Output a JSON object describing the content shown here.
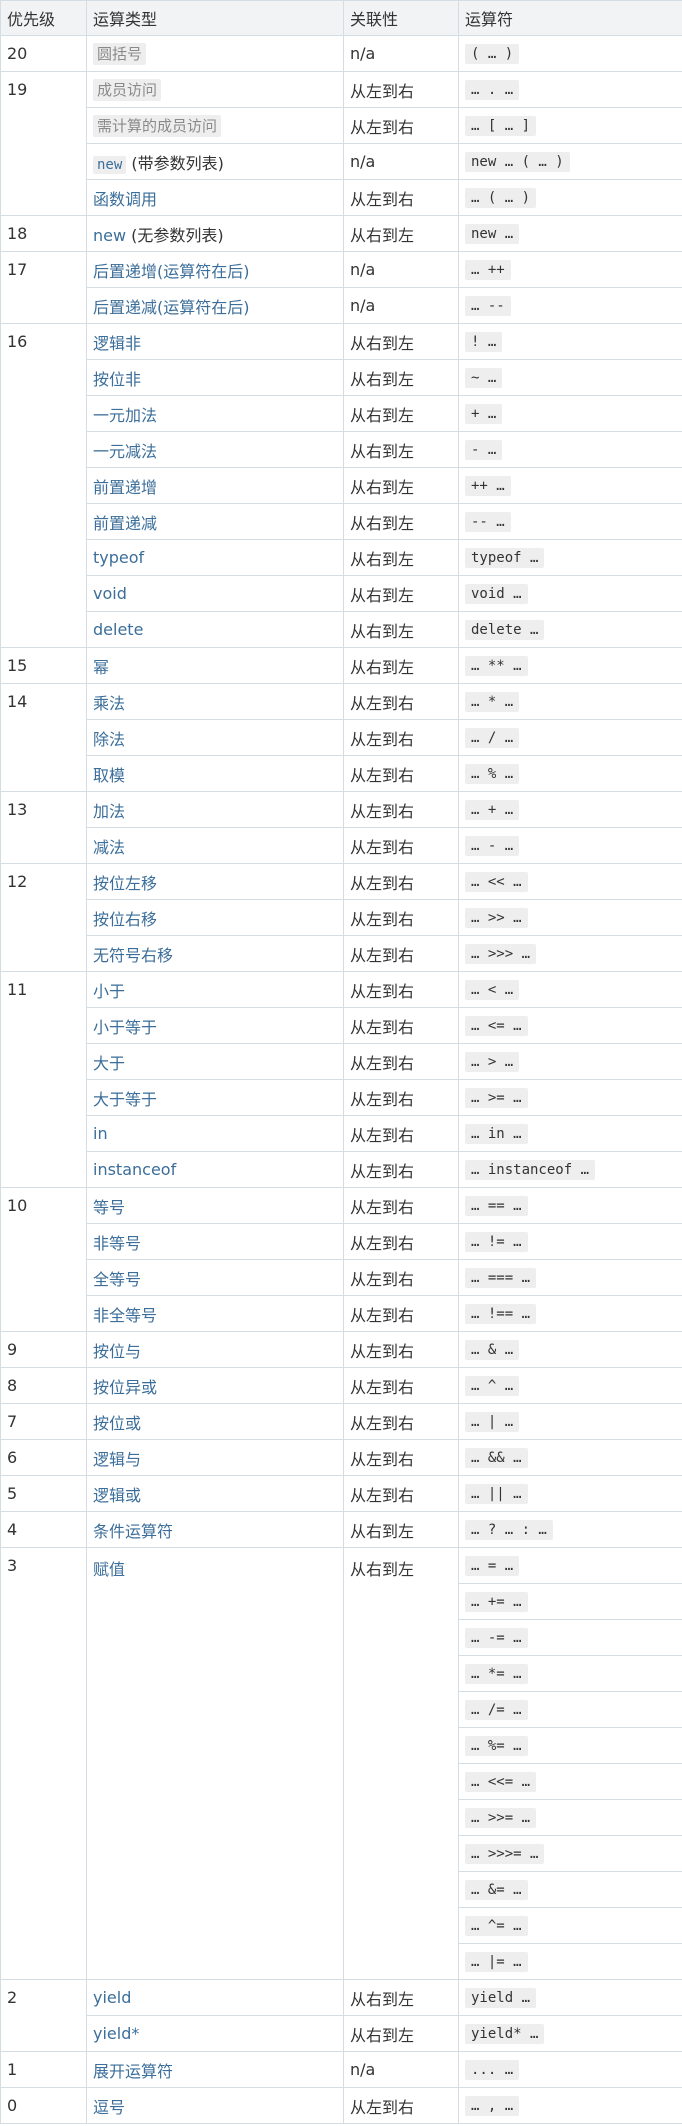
{
  "headers": {
    "precedence": "优先级",
    "type": "运算类型",
    "assoc": "关联性",
    "operator": "运算符"
  },
  "rows": [
    {
      "prec": "20",
      "type": "圆括号",
      "assoc": "n/a",
      "op": "( … )"
    },
    {
      "prec": "19",
      "type": "成员访问",
      "assoc": "从左到右",
      "op": "… . …"
    },
    {
      "type": "需计算的成员访问",
      "assoc": "从左到右",
      "op": "… [ … ]"
    },
    {
      "type_code": "new",
      "type_suffix": " (带参数列表)",
      "assoc": "n/a",
      "op": "new … ( … )"
    },
    {
      "type": "函数调用",
      "assoc": "从左到右",
      "op": "… ( … )"
    },
    {
      "prec": "18",
      "type_link": "new",
      "type_suffix": " (无参数列表)",
      "assoc": "从右到左",
      "op": "new …"
    },
    {
      "prec": "17",
      "type": "后置递增(运算符在后)",
      "assoc": "n/a",
      "op": "… ++"
    },
    {
      "type": "后置递减(运算符在后)",
      "assoc": "n/a",
      "op": "… --"
    },
    {
      "prec": "16",
      "type": "逻辑非",
      "assoc": "从右到左",
      "op": "! …"
    },
    {
      "type": "按位非",
      "assoc": "从右到左",
      "op": "~ …"
    },
    {
      "type": "一元加法",
      "assoc": "从右到左",
      "op": "+ …"
    },
    {
      "type": "一元减法",
      "assoc": "从右到左",
      "op": "- …"
    },
    {
      "type": "前置递增",
      "assoc": "从右到左",
      "op": "++ …"
    },
    {
      "type": "前置递减",
      "assoc": "从右到左",
      "op": "-- …"
    },
    {
      "type": "typeof",
      "assoc": "从右到左",
      "op": "typeof …"
    },
    {
      "type": "void",
      "assoc": "从右到左",
      "op": "void …"
    },
    {
      "type": "delete",
      "assoc": "从右到左",
      "op": "delete …"
    },
    {
      "prec": "15",
      "type": "幂",
      "assoc": "从右到左",
      "op": "… ** …"
    },
    {
      "prec": "14",
      "type": "乘法",
      "assoc": "从左到右",
      "op": "… * …"
    },
    {
      "type": "除法",
      "assoc": "从左到右",
      "op": "… / …"
    },
    {
      "type": "取模",
      "assoc": "从左到右",
      "op": "… % …"
    },
    {
      "prec": "13",
      "type": "加法",
      "assoc": "从左到右",
      "op": "… + …"
    },
    {
      "type": "减法",
      "assoc": "从左到右",
      "op": "… - …"
    },
    {
      "prec": "12",
      "type": "按位左移",
      "assoc": "从左到右",
      "op": "… << …"
    },
    {
      "type": "按位右移",
      "assoc": "从左到右",
      "op": "… >> …"
    },
    {
      "type": "无符号右移",
      "assoc": "从左到右",
      "op": "… >>> …"
    },
    {
      "prec": "11",
      "type": "小于",
      "assoc": "从左到右",
      "op": "… < …"
    },
    {
      "type": "小于等于",
      "assoc": "从左到右",
      "op": "… <= …"
    },
    {
      "type": "大于",
      "assoc": "从左到右",
      "op": "… > …"
    },
    {
      "type": "大于等于",
      "assoc": "从左到右",
      "op": "… >= …"
    },
    {
      "type": "in",
      "assoc": "从左到右",
      "op": "… in …"
    },
    {
      "type": "instanceof",
      "assoc": "从左到右",
      "op": "… instanceof …"
    },
    {
      "prec": "10",
      "type": "等号",
      "assoc": "从左到右",
      "op": "… == …"
    },
    {
      "type": "非等号",
      "assoc": "从左到右",
      "op": "… != …"
    },
    {
      "type": "全等号",
      "assoc": "从左到右",
      "op": "… === …"
    },
    {
      "type": "非全等号",
      "assoc": "从左到右",
      "op": "… !== …"
    },
    {
      "prec": "9",
      "type": "按位与",
      "assoc": "从左到右",
      "op": "… & …"
    },
    {
      "prec": "8",
      "type": "按位异或",
      "assoc": "从左到右",
      "op": "… ^ …"
    },
    {
      "prec": "7",
      "type": "按位或",
      "assoc": "从左到右",
      "op": "… | …"
    },
    {
      "prec": "6",
      "type": "逻辑与",
      "assoc": "从左到右",
      "op": "… && …"
    },
    {
      "prec": "5",
      "type": "逻辑或",
      "assoc": "从左到右",
      "op": "… || …"
    },
    {
      "prec": "4",
      "type": "条件运算符",
      "assoc": "从右到左",
      "op": "… ? … : …"
    },
    {
      "prec": "3",
      "type": "赋值",
      "assoc": "从右到左",
      "op": "… = …"
    },
    {
      "op": "… += …"
    },
    {
      "op": "… -= …"
    },
    {
      "op": "… *= …"
    },
    {
      "op": "… /= …"
    },
    {
      "op": "… %= …"
    },
    {
      "op": "… <<= …"
    },
    {
      "op": "… >>= …"
    },
    {
      "op": "… >>>= …"
    },
    {
      "op": "… &= …"
    },
    {
      "op": "… ^= …"
    },
    {
      "op": "… |= …"
    },
    {
      "prec": "2",
      "type": "yield",
      "assoc": "从右到左",
      "op": "yield …"
    },
    {
      "type": "yield*",
      "assoc": "从右到左",
      "op": "yield* …"
    },
    {
      "prec": "1",
      "type": "展开运算符",
      "assoc": "n/a",
      "op": "... …"
    },
    {
      "prec": "0",
      "type": "逗号",
      "assoc": "从左到右",
      "op": "… , …"
    }
  ]
}
